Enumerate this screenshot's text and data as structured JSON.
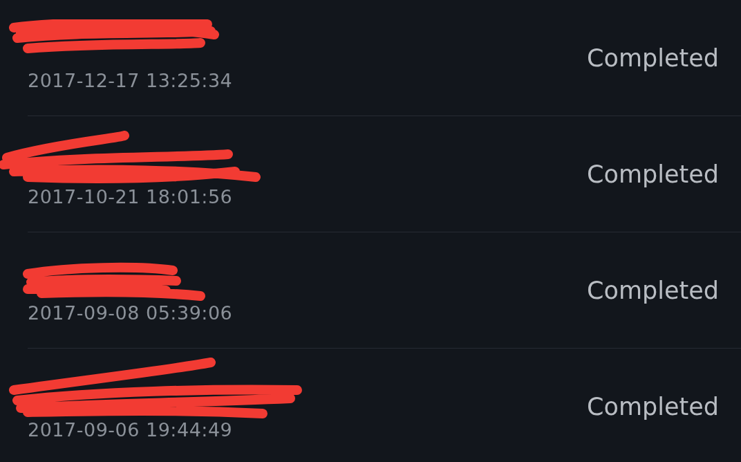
{
  "rows": [
    {
      "redacted": true,
      "date": "2017-12-17 13:25:34",
      "status": "Completed"
    },
    {
      "redacted": true,
      "date": "2017-10-21 18:01:56",
      "status": "Completed"
    },
    {
      "redacted": true,
      "date": "2017-09-08 05:39:06",
      "status": "Completed"
    },
    {
      "redacted": true,
      "date": "2017-09-06 19:44:49",
      "status": "Completed"
    }
  ]
}
